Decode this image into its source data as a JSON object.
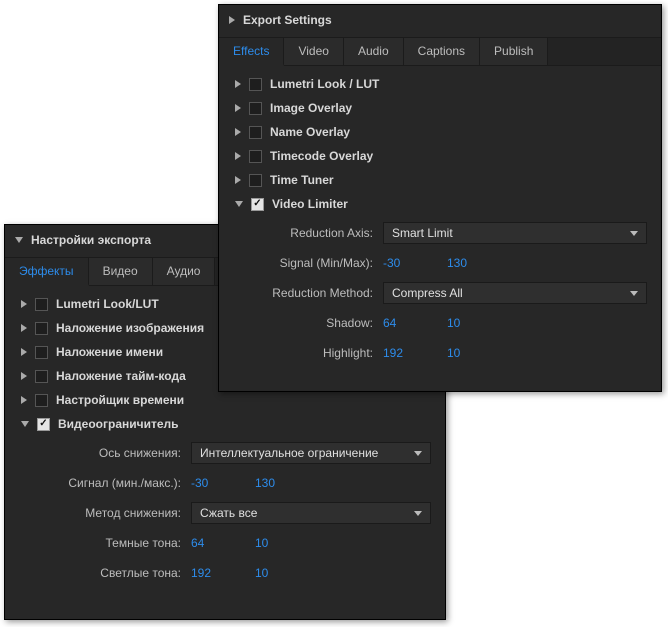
{
  "en": {
    "header": "Export Settings",
    "tabs": [
      "Effects",
      "Video",
      "Audio",
      "Captions",
      "Publish"
    ],
    "effects": [
      {
        "label": "Lumetri Look / LUT",
        "checked": false,
        "expanded": false
      },
      {
        "label": "Image Overlay",
        "checked": false,
        "expanded": false
      },
      {
        "label": "Name Overlay",
        "checked": false,
        "expanded": false
      },
      {
        "label": "Timecode Overlay",
        "checked": false,
        "expanded": false
      },
      {
        "label": "Time Tuner",
        "checked": false,
        "expanded": false
      },
      {
        "label": "Video Limiter",
        "checked": true,
        "expanded": true
      }
    ],
    "limiter": {
      "reduction_axis_label": "Reduction Axis:",
      "reduction_axis_value": "Smart Limit",
      "signal_label": "Signal (Min/Max):",
      "signal_min": "-30",
      "signal_max": "130",
      "reduction_method_label": "Reduction Method:",
      "reduction_method_value": "Compress All",
      "shadow_label": "Shadow:",
      "shadow_a": "64",
      "shadow_b": "10",
      "highlight_label": "Highlight:",
      "highlight_a": "192",
      "highlight_b": "10"
    }
  },
  "ru": {
    "header": "Настройки экспорта",
    "tabs": [
      "Эффекты",
      "Видео",
      "Аудио"
    ],
    "effects": [
      {
        "label": "Lumetri Look/LUT",
        "checked": false,
        "expanded": false
      },
      {
        "label": "Наложение изображения",
        "checked": false,
        "expanded": false
      },
      {
        "label": "Наложение имени",
        "checked": false,
        "expanded": false
      },
      {
        "label": "Наложение тайм-кода",
        "checked": false,
        "expanded": false
      },
      {
        "label": "Настройщик времени",
        "checked": false,
        "expanded": false
      },
      {
        "label": "Видеоограничитель",
        "checked": true,
        "expanded": true
      }
    ],
    "limiter": {
      "reduction_axis_label": "Ось снижения:",
      "reduction_axis_value": "Интеллектуальное ограничение",
      "signal_label": "Сигнал (мин./макс.):",
      "signal_min": "-30",
      "signal_max": "130",
      "reduction_method_label": "Метод снижения:",
      "reduction_method_value": "Сжать все",
      "shadow_label": "Темные тона:",
      "shadow_a": "64",
      "shadow_b": "10",
      "highlight_label": "Светлые тона:",
      "highlight_a": "192",
      "highlight_b": "10"
    }
  }
}
